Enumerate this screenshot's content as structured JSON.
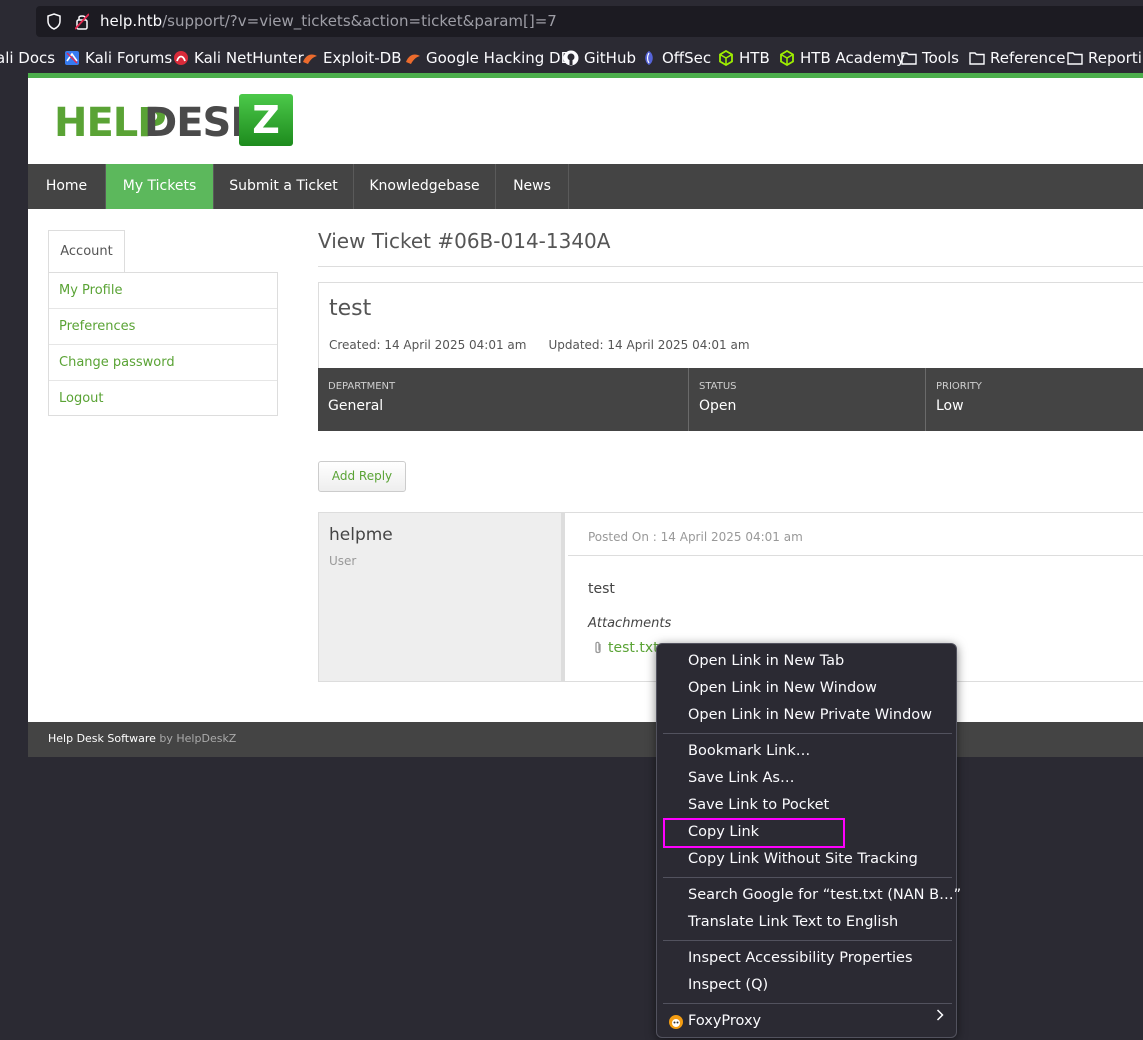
{
  "browser": {
    "url_host": "help.htb",
    "url_path": "/support/?v=view_tickets&action=ticket&param[]=7"
  },
  "bookmarks": [
    {
      "label": "ali Docs",
      "icon": "kali-icon"
    },
    {
      "label": "Kali Forums",
      "icon": "kali-forums-icon"
    },
    {
      "label": "Kali NetHunter",
      "icon": "nethunter-icon"
    },
    {
      "label": "Exploit-DB",
      "icon": "exploitdb-icon"
    },
    {
      "label": "Google Hacking DB",
      "icon": "ghdb-icon"
    },
    {
      "label": "GitHub",
      "icon": "github-icon"
    },
    {
      "label": "OffSec",
      "icon": "offsec-icon"
    },
    {
      "label": "HTB",
      "icon": "htb-icon"
    },
    {
      "label": "HTB Academy",
      "icon": "htb-academy-icon"
    },
    {
      "label": "Tools",
      "icon": "folder-icon"
    },
    {
      "label": "Reference",
      "icon": "folder-icon"
    },
    {
      "label": "Reportin",
      "icon": "folder-icon"
    }
  ],
  "site": {
    "logo": {
      "help": "HELP",
      "desk": "DESK",
      "z": "Z"
    },
    "nav": [
      "Home",
      "My Tickets",
      "Submit a Ticket",
      "Knowledgebase",
      "News"
    ],
    "nav_active": "My Tickets",
    "account_tab": "Account",
    "account_links": [
      "My Profile",
      "Preferences",
      "Change password",
      "Logout"
    ],
    "footer": {
      "text": "Help Desk Software",
      "by": "by HelpDeskZ"
    }
  },
  "ticket": {
    "heading": "View Ticket #06B-014-1340A",
    "subject": "test",
    "created": "Created: 14 April 2025 04:01 am",
    "updated": "Updated: 14 April 2025 04:01 am",
    "department_label": "DEPARTMENT",
    "department": "General",
    "status_label": "STATUS",
    "status": "Open",
    "priority_label": "PRIORITY",
    "priority": "Low",
    "add_reply": "Add Reply",
    "reply": {
      "user": "helpme",
      "role": "User",
      "posted_on": "Posted On : 14 April 2025 04:01 am",
      "body": "test",
      "attachments_title": "Attachments",
      "attachment": "test.txt"
    }
  },
  "context_menu": {
    "groups": [
      [
        "Open Link in New Tab",
        "Open Link in New Window",
        "Open Link in New Private Window"
      ],
      [
        "Bookmark Link…",
        "Save Link As…",
        "Save Link to Pocket",
        "Copy Link",
        "Copy Link Without Site Tracking"
      ],
      [
        "Search Google for “test.txt (NAN B…”",
        "Translate Link Text to English"
      ],
      [
        "Inspect Accessibility Properties",
        "Inspect (Q)"
      ],
      [
        "FoxyProxy"
      ]
    ],
    "highlighted": "Copy Link",
    "highlight_color": "#ff00ff"
  },
  "colors": {
    "brand_green": "#5cb85c",
    "nav_dark": "#444444",
    "browser_bg": "#2b2a33"
  }
}
